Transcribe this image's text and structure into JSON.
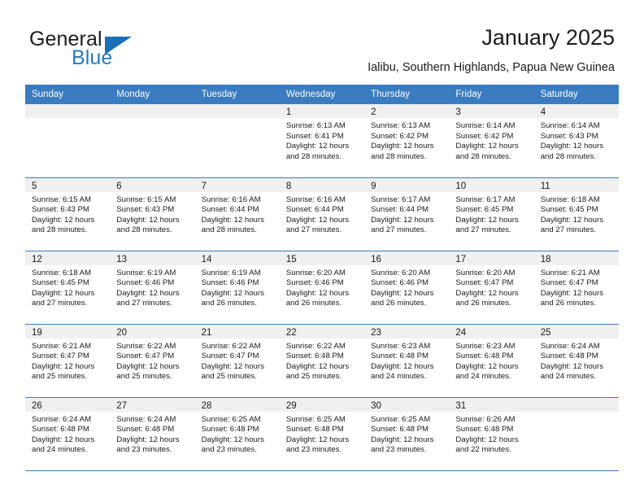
{
  "brand": {
    "name_part1": "General",
    "name_part2": "Blue",
    "flag_icon": "blue-triangle-flag-icon"
  },
  "header": {
    "title": "January 2025",
    "subtitle": "Ialibu, Southern Highlands, Papua New Guinea"
  },
  "colors": {
    "header_blue": "#3b7cc0",
    "brand_blue": "#1f7bc1",
    "daynum_band": "#f0f0f0",
    "text": "#1b1b1b"
  },
  "weekday_headers": [
    "Sunday",
    "Monday",
    "Tuesday",
    "Wednesday",
    "Thursday",
    "Friday",
    "Saturday"
  ],
  "weeks": [
    [
      {
        "day": "",
        "blank": true,
        "sunrise": "",
        "sunset": "",
        "daylight1": "",
        "daylight2": ""
      },
      {
        "day": "",
        "blank": true,
        "sunrise": "",
        "sunset": "",
        "daylight1": "",
        "daylight2": ""
      },
      {
        "day": "",
        "blank": true,
        "sunrise": "",
        "sunset": "",
        "daylight1": "",
        "daylight2": ""
      },
      {
        "day": "1",
        "blank": false,
        "sunrise": "Sunrise: 6:13 AM",
        "sunset": "Sunset: 6:41 PM",
        "daylight1": "Daylight: 12 hours",
        "daylight2": "and 28 minutes."
      },
      {
        "day": "2",
        "blank": false,
        "sunrise": "Sunrise: 6:13 AM",
        "sunset": "Sunset: 6:42 PM",
        "daylight1": "Daylight: 12 hours",
        "daylight2": "and 28 minutes."
      },
      {
        "day": "3",
        "blank": false,
        "sunrise": "Sunrise: 6:14 AM",
        "sunset": "Sunset: 6:42 PM",
        "daylight1": "Daylight: 12 hours",
        "daylight2": "and 28 minutes."
      },
      {
        "day": "4",
        "blank": false,
        "sunrise": "Sunrise: 6:14 AM",
        "sunset": "Sunset: 6:43 PM",
        "daylight1": "Daylight: 12 hours",
        "daylight2": "and 28 minutes."
      }
    ],
    [
      {
        "day": "5",
        "blank": false,
        "sunrise": "Sunrise: 6:15 AM",
        "sunset": "Sunset: 6:43 PM",
        "daylight1": "Daylight: 12 hours",
        "daylight2": "and 28 minutes."
      },
      {
        "day": "6",
        "blank": false,
        "sunrise": "Sunrise: 6:15 AM",
        "sunset": "Sunset: 6:43 PM",
        "daylight1": "Daylight: 12 hours",
        "daylight2": "and 28 minutes."
      },
      {
        "day": "7",
        "blank": false,
        "sunrise": "Sunrise: 6:16 AM",
        "sunset": "Sunset: 6:44 PM",
        "daylight1": "Daylight: 12 hours",
        "daylight2": "and 28 minutes."
      },
      {
        "day": "8",
        "blank": false,
        "sunrise": "Sunrise: 6:16 AM",
        "sunset": "Sunset: 6:44 PM",
        "daylight1": "Daylight: 12 hours",
        "daylight2": "and 27 minutes."
      },
      {
        "day": "9",
        "blank": false,
        "sunrise": "Sunrise: 6:17 AM",
        "sunset": "Sunset: 6:44 PM",
        "daylight1": "Daylight: 12 hours",
        "daylight2": "and 27 minutes."
      },
      {
        "day": "10",
        "blank": false,
        "sunrise": "Sunrise: 6:17 AM",
        "sunset": "Sunset: 6:45 PM",
        "daylight1": "Daylight: 12 hours",
        "daylight2": "and 27 minutes."
      },
      {
        "day": "11",
        "blank": false,
        "sunrise": "Sunrise: 6:18 AM",
        "sunset": "Sunset: 6:45 PM",
        "daylight1": "Daylight: 12 hours",
        "daylight2": "and 27 minutes."
      }
    ],
    [
      {
        "day": "12",
        "blank": false,
        "sunrise": "Sunrise: 6:18 AM",
        "sunset": "Sunset: 6:45 PM",
        "daylight1": "Daylight: 12 hours",
        "daylight2": "and 27 minutes."
      },
      {
        "day": "13",
        "blank": false,
        "sunrise": "Sunrise: 6:19 AM",
        "sunset": "Sunset: 6:46 PM",
        "daylight1": "Daylight: 12 hours",
        "daylight2": "and 27 minutes."
      },
      {
        "day": "14",
        "blank": false,
        "sunrise": "Sunrise: 6:19 AM",
        "sunset": "Sunset: 6:46 PM",
        "daylight1": "Daylight: 12 hours",
        "daylight2": "and 26 minutes."
      },
      {
        "day": "15",
        "blank": false,
        "sunrise": "Sunrise: 6:20 AM",
        "sunset": "Sunset: 6:46 PM",
        "daylight1": "Daylight: 12 hours",
        "daylight2": "and 26 minutes."
      },
      {
        "day": "16",
        "blank": false,
        "sunrise": "Sunrise: 6:20 AM",
        "sunset": "Sunset: 6:46 PM",
        "daylight1": "Daylight: 12 hours",
        "daylight2": "and 26 minutes."
      },
      {
        "day": "17",
        "blank": false,
        "sunrise": "Sunrise: 6:20 AM",
        "sunset": "Sunset: 6:47 PM",
        "daylight1": "Daylight: 12 hours",
        "daylight2": "and 26 minutes."
      },
      {
        "day": "18",
        "blank": false,
        "sunrise": "Sunrise: 6:21 AM",
        "sunset": "Sunset: 6:47 PM",
        "daylight1": "Daylight: 12 hours",
        "daylight2": "and 26 minutes."
      }
    ],
    [
      {
        "day": "19",
        "blank": false,
        "sunrise": "Sunrise: 6:21 AM",
        "sunset": "Sunset: 6:47 PM",
        "daylight1": "Daylight: 12 hours",
        "daylight2": "and 25 minutes."
      },
      {
        "day": "20",
        "blank": false,
        "sunrise": "Sunrise: 6:22 AM",
        "sunset": "Sunset: 6:47 PM",
        "daylight1": "Daylight: 12 hours",
        "daylight2": "and 25 minutes."
      },
      {
        "day": "21",
        "blank": false,
        "sunrise": "Sunrise: 6:22 AM",
        "sunset": "Sunset: 6:47 PM",
        "daylight1": "Daylight: 12 hours",
        "daylight2": "and 25 minutes."
      },
      {
        "day": "22",
        "blank": false,
        "sunrise": "Sunrise: 6:22 AM",
        "sunset": "Sunset: 6:48 PM",
        "daylight1": "Daylight: 12 hours",
        "daylight2": "and 25 minutes."
      },
      {
        "day": "23",
        "blank": false,
        "sunrise": "Sunrise: 6:23 AM",
        "sunset": "Sunset: 6:48 PM",
        "daylight1": "Daylight: 12 hours",
        "daylight2": "and 24 minutes."
      },
      {
        "day": "24",
        "blank": false,
        "sunrise": "Sunrise: 6:23 AM",
        "sunset": "Sunset: 6:48 PM",
        "daylight1": "Daylight: 12 hours",
        "daylight2": "and 24 minutes."
      },
      {
        "day": "25",
        "blank": false,
        "sunrise": "Sunrise: 6:24 AM",
        "sunset": "Sunset: 6:48 PM",
        "daylight1": "Daylight: 12 hours",
        "daylight2": "and 24 minutes."
      }
    ],
    [
      {
        "day": "26",
        "blank": false,
        "sunrise": "Sunrise: 6:24 AM",
        "sunset": "Sunset: 6:48 PM",
        "daylight1": "Daylight: 12 hours",
        "daylight2": "and 24 minutes."
      },
      {
        "day": "27",
        "blank": false,
        "sunrise": "Sunrise: 6:24 AM",
        "sunset": "Sunset: 6:48 PM",
        "daylight1": "Daylight: 12 hours",
        "daylight2": "and 23 minutes."
      },
      {
        "day": "28",
        "blank": false,
        "sunrise": "Sunrise: 6:25 AM",
        "sunset": "Sunset: 6:48 PM",
        "daylight1": "Daylight: 12 hours",
        "daylight2": "and 23 minutes."
      },
      {
        "day": "29",
        "blank": false,
        "sunrise": "Sunrise: 6:25 AM",
        "sunset": "Sunset: 6:48 PM",
        "daylight1": "Daylight: 12 hours",
        "daylight2": "and 23 minutes."
      },
      {
        "day": "30",
        "blank": false,
        "sunrise": "Sunrise: 6:25 AM",
        "sunset": "Sunset: 6:48 PM",
        "daylight1": "Daylight: 12 hours",
        "daylight2": "and 23 minutes."
      },
      {
        "day": "31",
        "blank": false,
        "sunrise": "Sunrise: 6:26 AM",
        "sunset": "Sunset: 6:48 PM",
        "daylight1": "Daylight: 12 hours",
        "daylight2": "and 22 minutes."
      },
      {
        "day": "",
        "blank": true,
        "sunrise": "",
        "sunset": "",
        "daylight1": "",
        "daylight2": ""
      }
    ]
  ]
}
